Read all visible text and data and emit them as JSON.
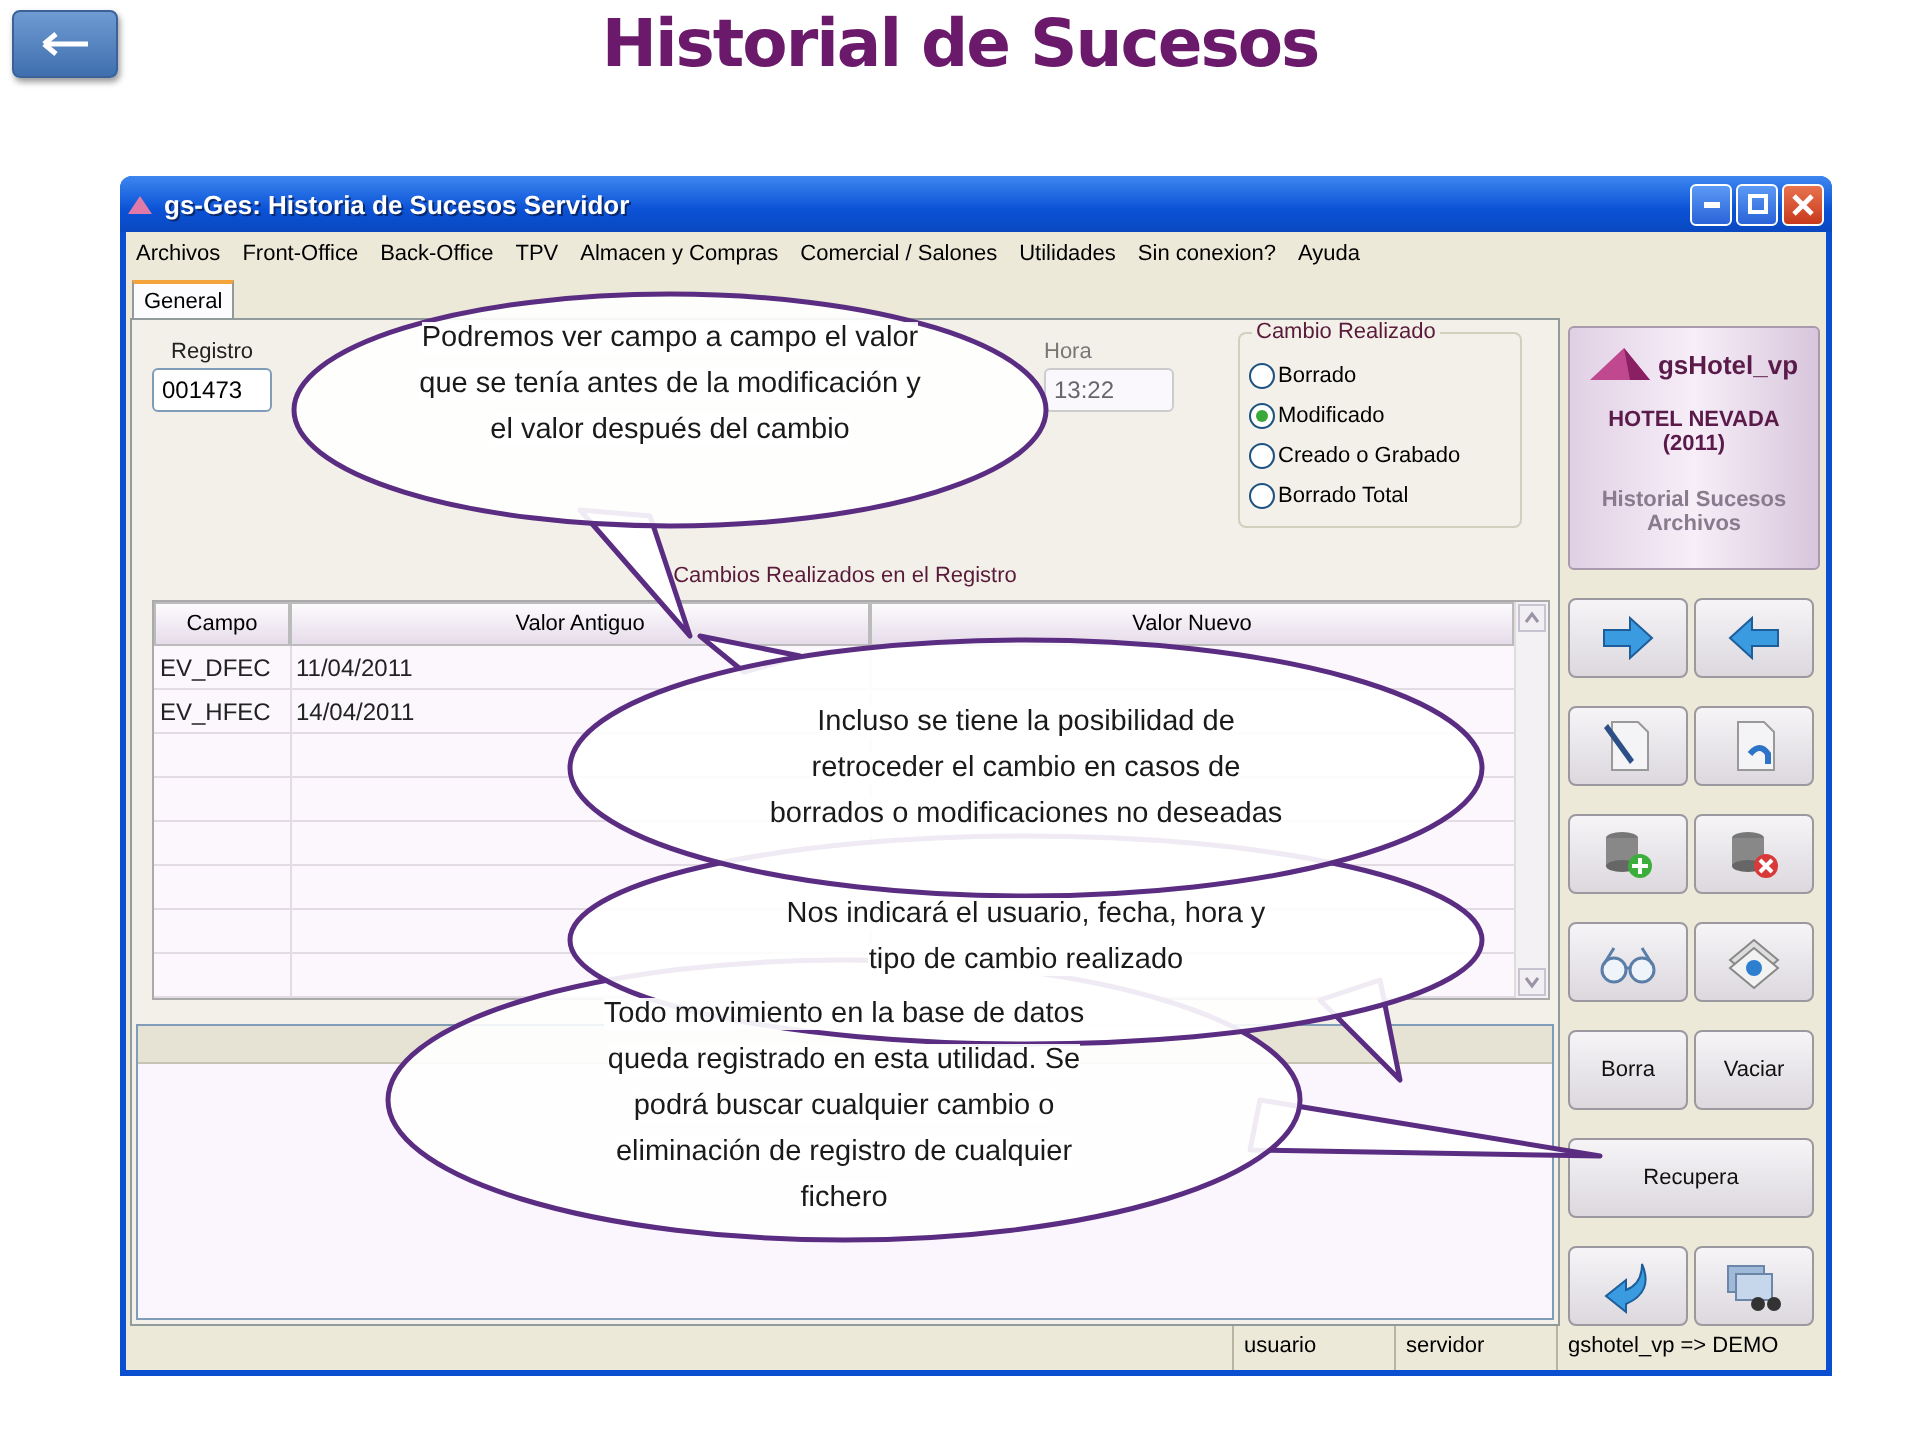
{
  "slide": {
    "title": "Historial de Sucesos"
  },
  "window": {
    "title": "gs-Ges: Historia de Sucesos Servidor"
  },
  "menu": [
    "Archivos",
    "Front-Office",
    "Back-Office",
    "TPV",
    "Almacen y Compras",
    "Comercial / Salones",
    "Utilidades",
    "Sin conexion?",
    "Ayuda"
  ],
  "tabs": [
    {
      "label": "General",
      "selected": true
    }
  ],
  "form": {
    "registro": {
      "label": "Registro",
      "value": "001473"
    },
    "hora": {
      "label": "Hora",
      "value": "13:22"
    }
  },
  "cambio_realizado": {
    "title": "Cambio Realizado",
    "options": [
      {
        "label": "Borrado",
        "selected": false
      },
      {
        "label": "Modificado",
        "selected": true
      },
      {
        "label": "Creado o Grabado",
        "selected": false
      },
      {
        "label": "Borrado Total",
        "selected": false
      }
    ]
  },
  "table": {
    "caption": "Cambios Realizados en el Registro",
    "columns": [
      "Campo",
      "Valor Antiguo",
      "Valor Nuevo"
    ],
    "rows": [
      [
        "EV_DFEC",
        "11/04/2011"
      ],
      [
        "EV_HFEC",
        "14/04/2011"
      ]
    ]
  },
  "logo": {
    "name": "gsHotel_vp",
    "hotel": "HOTEL NEVADA",
    "year": "(2011)",
    "module": "Historial Sucesos Archivos"
  },
  "sidebar_buttons": [
    [
      {
        "kind": "icon"
      },
      {
        "kind": "icon"
      }
    ],
    [
      {
        "kind": "icon"
      },
      {
        "kind": "icon"
      }
    ],
    [
      {
        "kind": "icon"
      },
      {
        "kind": "icon"
      }
    ],
    [
      {
        "kind": "icon"
      },
      {
        "kind": "icon"
      }
    ],
    [
      {
        "kind": "text",
        "label": "Borra"
      },
      {
        "kind": "text",
        "label": "Vaciar"
      }
    ],
    [
      {
        "kind": "text",
        "label": "Recupera"
      }
    ],
    [
      {
        "kind": "icon"
      },
      {
        "kind": "icon"
      }
    ]
  ],
  "status_bar": [
    "usuario",
    "servidor",
    "gshotel_vp => DEMO"
  ],
  "callouts": [
    {
      "lines": [
        "Podremos ver campo a campo el valor",
        "que se tenía antes de la modificación y",
        "el valor después del cambio"
      ]
    },
    {
      "lines": [
        "Incluso se tiene la posibilidad de",
        "retroceder el cambio en casos de",
        "borrados o modificaciones no deseadas"
      ]
    },
    {
      "lines": [
        "Nos indicará el usuario, fecha, hora y",
        "tipo de cambio realizado"
      ]
    },
    {
      "lines": [
        "Todo movimiento en la base de datos",
        "queda registrado en esta utilidad. Se",
        "podrá buscar cualquier cambio o",
        "eliminación de registro de cualquier",
        "fichero"
      ]
    }
  ]
}
